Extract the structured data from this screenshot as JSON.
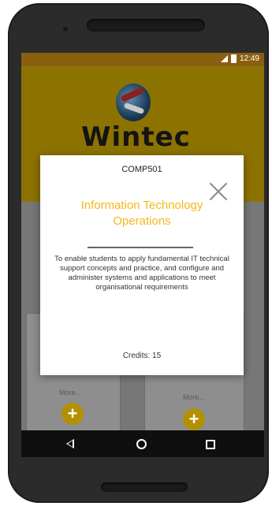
{
  "status_bar": {
    "time": "12:49"
  },
  "header": {
    "logo_text": "Wintec"
  },
  "cards": [
    {
      "more_label": "More...",
      "add_label": "+"
    },
    {
      "more_label": "More...",
      "add_label": "+"
    }
  ],
  "dialog": {
    "course_code": "COMP501",
    "course_title": "Information Technology Operations",
    "description": "To enable students to apply fundamental IT technical support concepts and practice, and configure and administer systems and applications to meet organisational requirements",
    "credits": "Credits: 15"
  },
  "colors": {
    "accent": "#f5b71a",
    "header": "#8c7300",
    "status_bar": "#8a5f10",
    "nav_bar": "#0f0f0f"
  },
  "icons": [
    "signal-icon",
    "battery-icon",
    "close-icon",
    "back-icon",
    "home-icon",
    "recents-icon",
    "plus-icon"
  ]
}
